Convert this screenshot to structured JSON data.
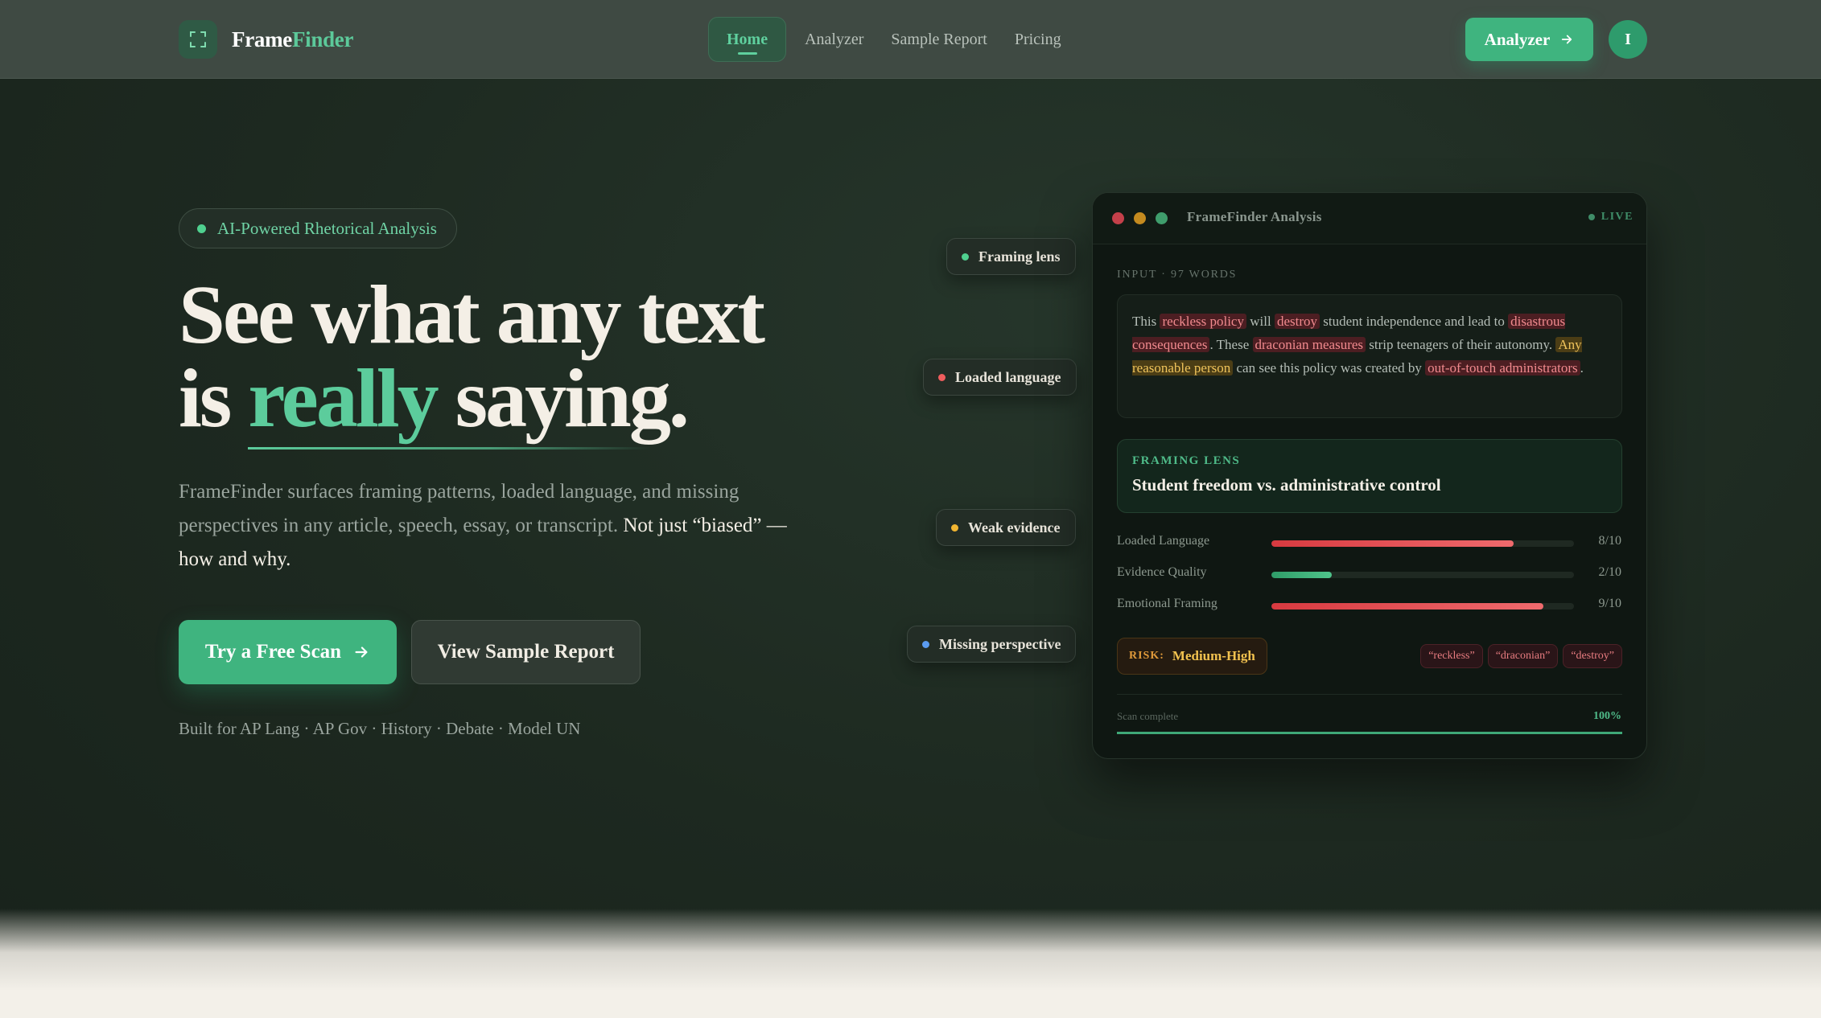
{
  "nav": {
    "logo_frame": "Frame",
    "logo_finder": "Finder",
    "links": [
      {
        "label": "Home",
        "active": true
      },
      {
        "label": "Analyzer"
      },
      {
        "label": "Sample Report"
      },
      {
        "label": "Pricing"
      }
    ],
    "cta_label": "Analyzer",
    "avatar_initial": "I"
  },
  "hero": {
    "badge": "AI-Powered Rhetorical Analysis",
    "headline_line1": "See what any text",
    "headline_is": "is",
    "headline_really": "really",
    "headline_saying": "saying.",
    "subcopy_plain": "FrameFinder surfaces framing patterns, loaded language, and missing perspectives in any article, speech, essay, or transcript.",
    "subcopy_strong": "Not just “biased” — how and why.",
    "primary_button": "Try a Free Scan",
    "secondary_button": "View Sample Report",
    "built_for": "Built for AP Lang · AP Gov · History · Debate · Model UN"
  },
  "tags": [
    {
      "label": "Framing lens",
      "color": "#4fd08f"
    },
    {
      "label": "Loaded language",
      "color": "#ef5d5d"
    },
    {
      "label": "Weak evidence",
      "color": "#f2b631"
    },
    {
      "label": "Missing perspective",
      "color": "#5b9cf0"
    }
  ],
  "card": {
    "title": "FrameFinder Analysis",
    "live": "LIVE",
    "input_label": "INPUT · 97 WORDS",
    "text": {
      "t1": "This ",
      "h1": "reckless policy",
      "t2": " will ",
      "h2": "destroy",
      "t3": " student independence and lead to ",
      "h3": "disastrous consequences",
      "t4": ". These ",
      "h4": "draconian measures",
      "t5": " strip teenagers of their autonomy. ",
      "y1": "Any reasonable person",
      "t6": " can see this policy was created by ",
      "h5": "out-of-touch administrators",
      "t7": "."
    },
    "lens_label": "FRAMING LENS",
    "lens_value": "Student freedom vs. administrative control",
    "metrics": [
      {
        "label": "Loaded Language",
        "score": "8/10",
        "value": 8
      },
      {
        "label": "Evidence Quality",
        "score": "2/10",
        "value": 2
      },
      {
        "label": "Emotional Framing",
        "score": "9/10",
        "value": 9
      }
    ],
    "risk_label": "RISK:",
    "risk_value": "Medium-High",
    "chips": [
      "“reckless”",
      "“draconian”",
      "“destroy”"
    ],
    "scan_label": "Scan complete",
    "scan_pct": "100%",
    "scan_progress": 100
  },
  "colors": {
    "accent": "#3fb47f",
    "accent_light": "#5ccc9c",
    "danger": "#ef5d5d",
    "warning": "#f2c24f"
  }
}
